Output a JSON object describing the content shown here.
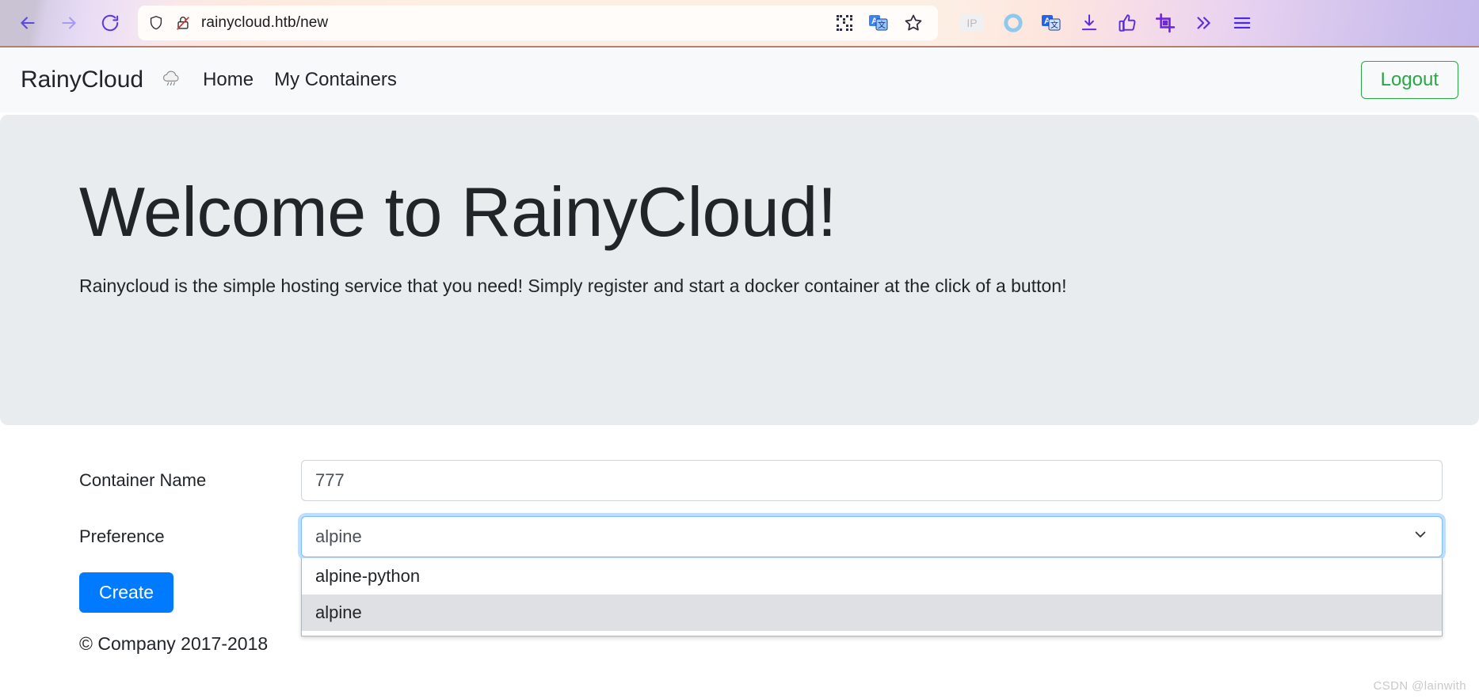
{
  "browser": {
    "back_icon": "back-arrow-icon",
    "forward_icon": "forward-arrow-icon",
    "reload_icon": "reload-icon",
    "shield_icon": "shield-icon",
    "insecure_icon": "insecure-lock-icon",
    "url": "rainycloud.htb/new",
    "urlbar_icons": [
      "qrcode-icon",
      "translate-icon",
      "bookmark-star-icon"
    ],
    "extension_icons": [
      "ip-badge-icon",
      "circle-ring-icon",
      "translate-extension-icon",
      "download-icon",
      "thumbs-up-icon",
      "screenshot-crop-icon",
      "overflow-chevrons-icon",
      "hamburger-menu-icon"
    ],
    "ip_label": "IP"
  },
  "navbar": {
    "brand": "RainyCloud",
    "cloud_icon_glyph": "🌧",
    "links": [
      {
        "label": "Home",
        "name": "nav-link-home"
      },
      {
        "label": "My Containers",
        "name": "nav-link-my-containers"
      }
    ],
    "logout_label": "Logout",
    "logout_color": "#28a745",
    "background": "#f8f9fa"
  },
  "hero": {
    "title": "Welcome to RainyCloud!",
    "lead": "Rainycloud is the simple hosting service that you need! Simply register and start a docker container at the click of a button!",
    "background": "#e9ecef"
  },
  "form": {
    "container_name": {
      "label": "Container Name",
      "value": "777",
      "placeholder": "Container Name"
    },
    "preference": {
      "label": "Preference",
      "selected": "alpine",
      "chevron_icon": "chevron-down-icon",
      "options": [
        {
          "label": "alpine-python",
          "selected": false
        },
        {
          "label": "alpine",
          "selected": true
        }
      ]
    },
    "create_label": "Create",
    "create_color": "#007bff"
  },
  "footer": {
    "copyright": "© Company 2017-2018"
  },
  "watermark": {
    "text": "CSDN @lainwith"
  }
}
